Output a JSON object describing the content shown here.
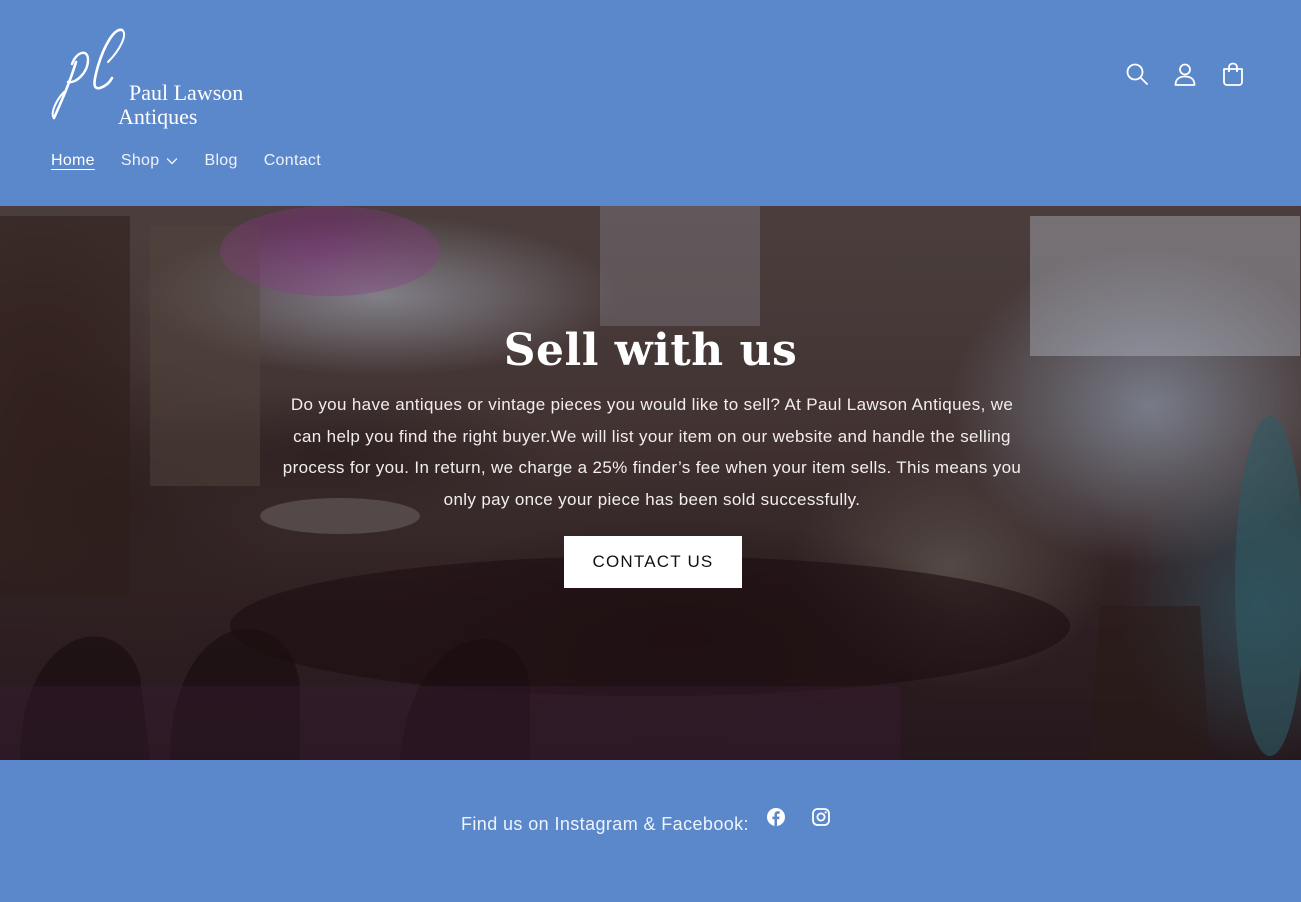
{
  "brand": {
    "monogram": "pl",
    "name_line1": "Paul Lawson",
    "name_line2": "Antiques"
  },
  "header": {
    "icons": [
      "search-icon",
      "account-icon",
      "cart-icon"
    ]
  },
  "nav": {
    "items": [
      {
        "label": "Home",
        "active": true
      },
      {
        "label": "Shop",
        "has_dropdown": true
      },
      {
        "label": "Blog"
      },
      {
        "label": "Contact"
      }
    ]
  },
  "hero": {
    "title": "Sell with us",
    "body": "Do you have antiques or vintage pieces you would like to sell? At Paul Lawson Antiques, we can help you find the right buyer.We will list your item on our website and handle the selling process for you. In return, we charge a 25% finder’s fee when your item sells. This means you only pay once your piece has been sold successfully.",
    "button_label": "CONTACT US"
  },
  "footer": {
    "social_text": "Find us on Instagram & Facebook:",
    "social_icons": [
      "facebook-icon",
      "instagram-icon"
    ]
  },
  "colors": {
    "brand_blue": "#5b87cb",
    "button_bg": "#ffffff",
    "button_text": "#121212"
  }
}
